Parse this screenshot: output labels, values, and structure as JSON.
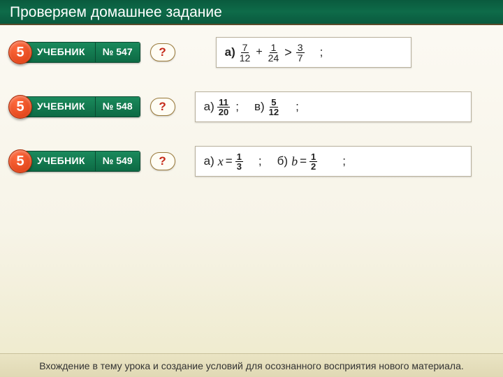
{
  "header": {
    "title": "Проверяем домашнее задание"
  },
  "badge_number": "5",
  "rows": [
    {
      "textbook_label": "УЧЕБНИК",
      "number_label": "№ 547",
      "question_mark": "?",
      "answer": {
        "parts": [
          {
            "label": "а)",
            "frac1": {
              "n": "7",
              "d": "12"
            },
            "op1": "+",
            "frac2": {
              "n": "1",
              "d": "24"
            },
            "op2": ">",
            "frac3": {
              "n": "3",
              "d": "7"
            },
            "tail": ";"
          }
        ]
      }
    },
    {
      "textbook_label": "УЧЕБНИК",
      "number_label": "№ 548",
      "question_mark": "?",
      "answer": {
        "parts": [
          {
            "label": "а)",
            "frac": {
              "n": "11",
              "d": "20"
            },
            "tail": ";"
          },
          {
            "label": "в)",
            "frac": {
              "n": "5",
              "d": "12"
            },
            "tail": ";"
          }
        ]
      }
    },
    {
      "textbook_label": "УЧЕБНИК",
      "number_label": "№ 549",
      "question_mark": "?",
      "answer": {
        "parts": [
          {
            "label": "а)",
            "var": "x",
            "eq": "=",
            "frac": {
              "n": "1",
              "d": "3"
            },
            "tail": ";"
          },
          {
            "label": "б)",
            "var": "b",
            "eq": "=",
            "frac": {
              "n": "1",
              "d": "2"
            },
            "tail": ";"
          }
        ]
      }
    }
  ],
  "footer": {
    "text": "Вхождение в тему урока и создание условий для осознанного восприятия нового материала."
  }
}
